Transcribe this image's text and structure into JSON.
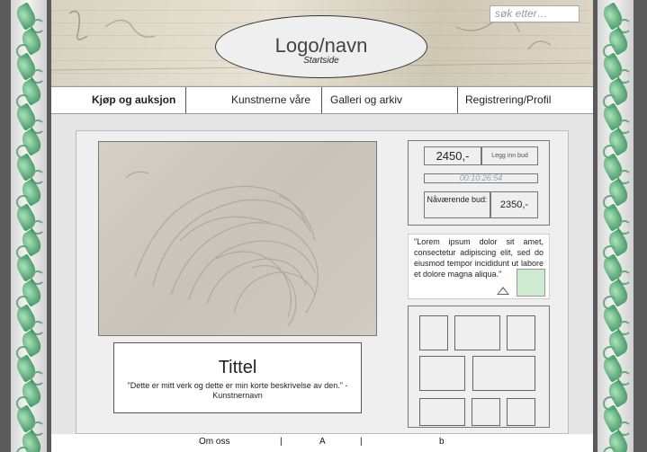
{
  "header": {
    "search_placeholder": "søk etter…",
    "logo_title": "Logo/navn",
    "logo_subtitle": "Startside"
  },
  "nav": {
    "items": [
      {
        "label": "Kjøp og auksjon",
        "active": true
      },
      {
        "label": "Kunstnerne våre",
        "active": false
      },
      {
        "label": "Galleri og arkiv",
        "active": false
      },
      {
        "label": "Registrering/Profil",
        "active": false
      }
    ]
  },
  "artwork": {
    "title": "Tittel",
    "quote": "\"Dette er mitt verk og dette er min korte beskrivelse av den.\"  - Kunstnernavn"
  },
  "bid": {
    "price": "2450,-",
    "place_bid_label": "Legg inn bud",
    "countdown": "00:10:26:54",
    "current_bid_label": "Nåværende bud:",
    "current_bid_value": "2350,-"
  },
  "review": {
    "text": "\"Lorem ipsum dolor sit amet, consectetur adipiscing elit, sed do eiusmod tempor incididunt ut labore et dolore magna aliqua.\""
  },
  "footer": {
    "about": "Om oss",
    "sep1": "|",
    "link_a": "A",
    "sep2": "|",
    "link_b": "b"
  },
  "colors": {
    "accent_green": "#cdeccf",
    "page_bg": "#e6e6e6",
    "border_leaf_green": "#2f8f55"
  }
}
